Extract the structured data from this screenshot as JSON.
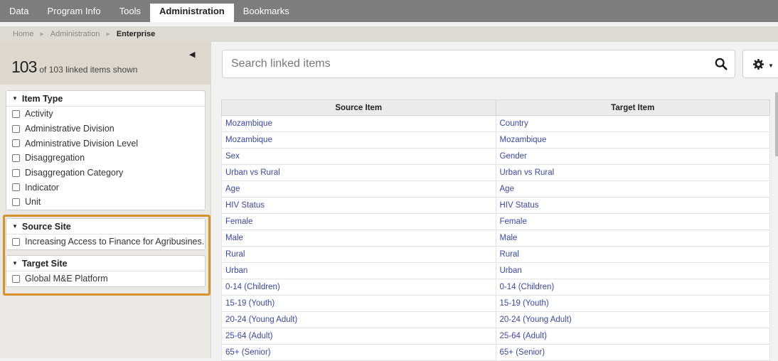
{
  "nav": {
    "tabs": [
      "Data",
      "Program Info",
      "Tools",
      "Administration",
      "Bookmarks"
    ],
    "active": "Administration"
  },
  "breadcrumb": [
    "Home",
    "Administration",
    "Enterprise"
  ],
  "sidebar": {
    "count_big": "103",
    "count_text": "of 103 linked items shown",
    "facets": [
      {
        "title": "Item Type",
        "options": [
          "Activity",
          "Administrative Division",
          "Administrative Division Level",
          "Disaggregation",
          "Disaggregation Category",
          "Indicator",
          "Unit"
        ]
      },
      {
        "title": "Source Site",
        "options": [
          "Increasing Access to Finance for Agribusines..."
        ]
      },
      {
        "title": "Target Site",
        "options": [
          "Global M&E Platform"
        ]
      }
    ]
  },
  "search": {
    "placeholder": "Search linked items"
  },
  "table": {
    "columns": [
      "Source Item",
      "Target Item"
    ],
    "rows": [
      [
        "Mozambique",
        "Country"
      ],
      [
        "Mozambique",
        "Mozambique"
      ],
      [
        "Sex",
        "Gender"
      ],
      [
        "Urban vs Rural",
        "Urban vs Rural"
      ],
      [
        "Age",
        "Age"
      ],
      [
        "HIV Status",
        "HIV Status"
      ],
      [
        "Female",
        "Female"
      ],
      [
        "Male",
        "Male"
      ],
      [
        "Rural",
        "Rural"
      ],
      [
        "Urban",
        "Urban"
      ],
      [
        "0-14 (Children)",
        "0-14 (Children)"
      ],
      [
        "15-19 (Youth)",
        "15-19 (Youth)"
      ],
      [
        "20-24 (Young Adult)",
        "20-24 (Young Adult)"
      ],
      [
        "25-64 (Adult)",
        "25-64 (Adult)"
      ],
      [
        "65+ (Senior)",
        "65+ (Senior)"
      ]
    ]
  },
  "colors": {
    "highlight": "#d9912b",
    "link": "#3a47a8",
    "topbar": "#7d7d7d"
  },
  "icons": {
    "search": "search-icon",
    "settings": "gear-icon",
    "collapse": "caret-left-icon"
  }
}
